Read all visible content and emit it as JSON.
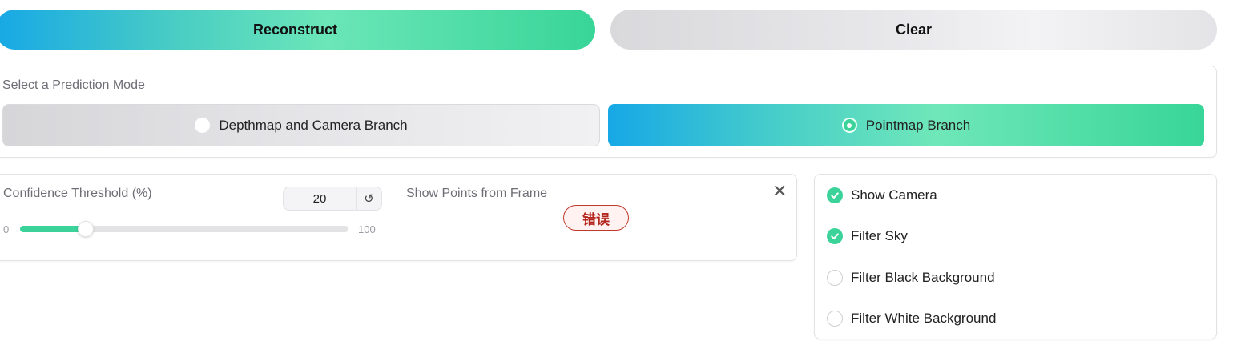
{
  "buttons": {
    "reconstruct": "Reconstruct",
    "clear": "Clear"
  },
  "prediction_mode": {
    "label": "Select a Prediction Mode",
    "options": [
      {
        "label": "Depthmap and Camera Branch",
        "selected": false
      },
      {
        "label": "Pointmap Branch",
        "selected": true
      }
    ]
  },
  "confidence": {
    "label": "Confidence Threshold (%)",
    "value": "20",
    "min_label": "0",
    "max_label": "100",
    "min": 0,
    "max": 100,
    "current": 20,
    "reset_glyph": "↺"
  },
  "frame": {
    "label": "Show Points from Frame",
    "error_badge": "错误",
    "close_glyph": "✕"
  },
  "options": [
    {
      "label": "Show Camera",
      "checked": true
    },
    {
      "label": "Filter Sky",
      "checked": true
    },
    {
      "label": "Filter Black Background",
      "checked": false
    },
    {
      "label": "Filter White Background",
      "checked": false
    }
  ],
  "colors": {
    "accent_green": "#3bd39a",
    "accent_blue": "#17a8e6",
    "error_red": "#b3261e"
  }
}
